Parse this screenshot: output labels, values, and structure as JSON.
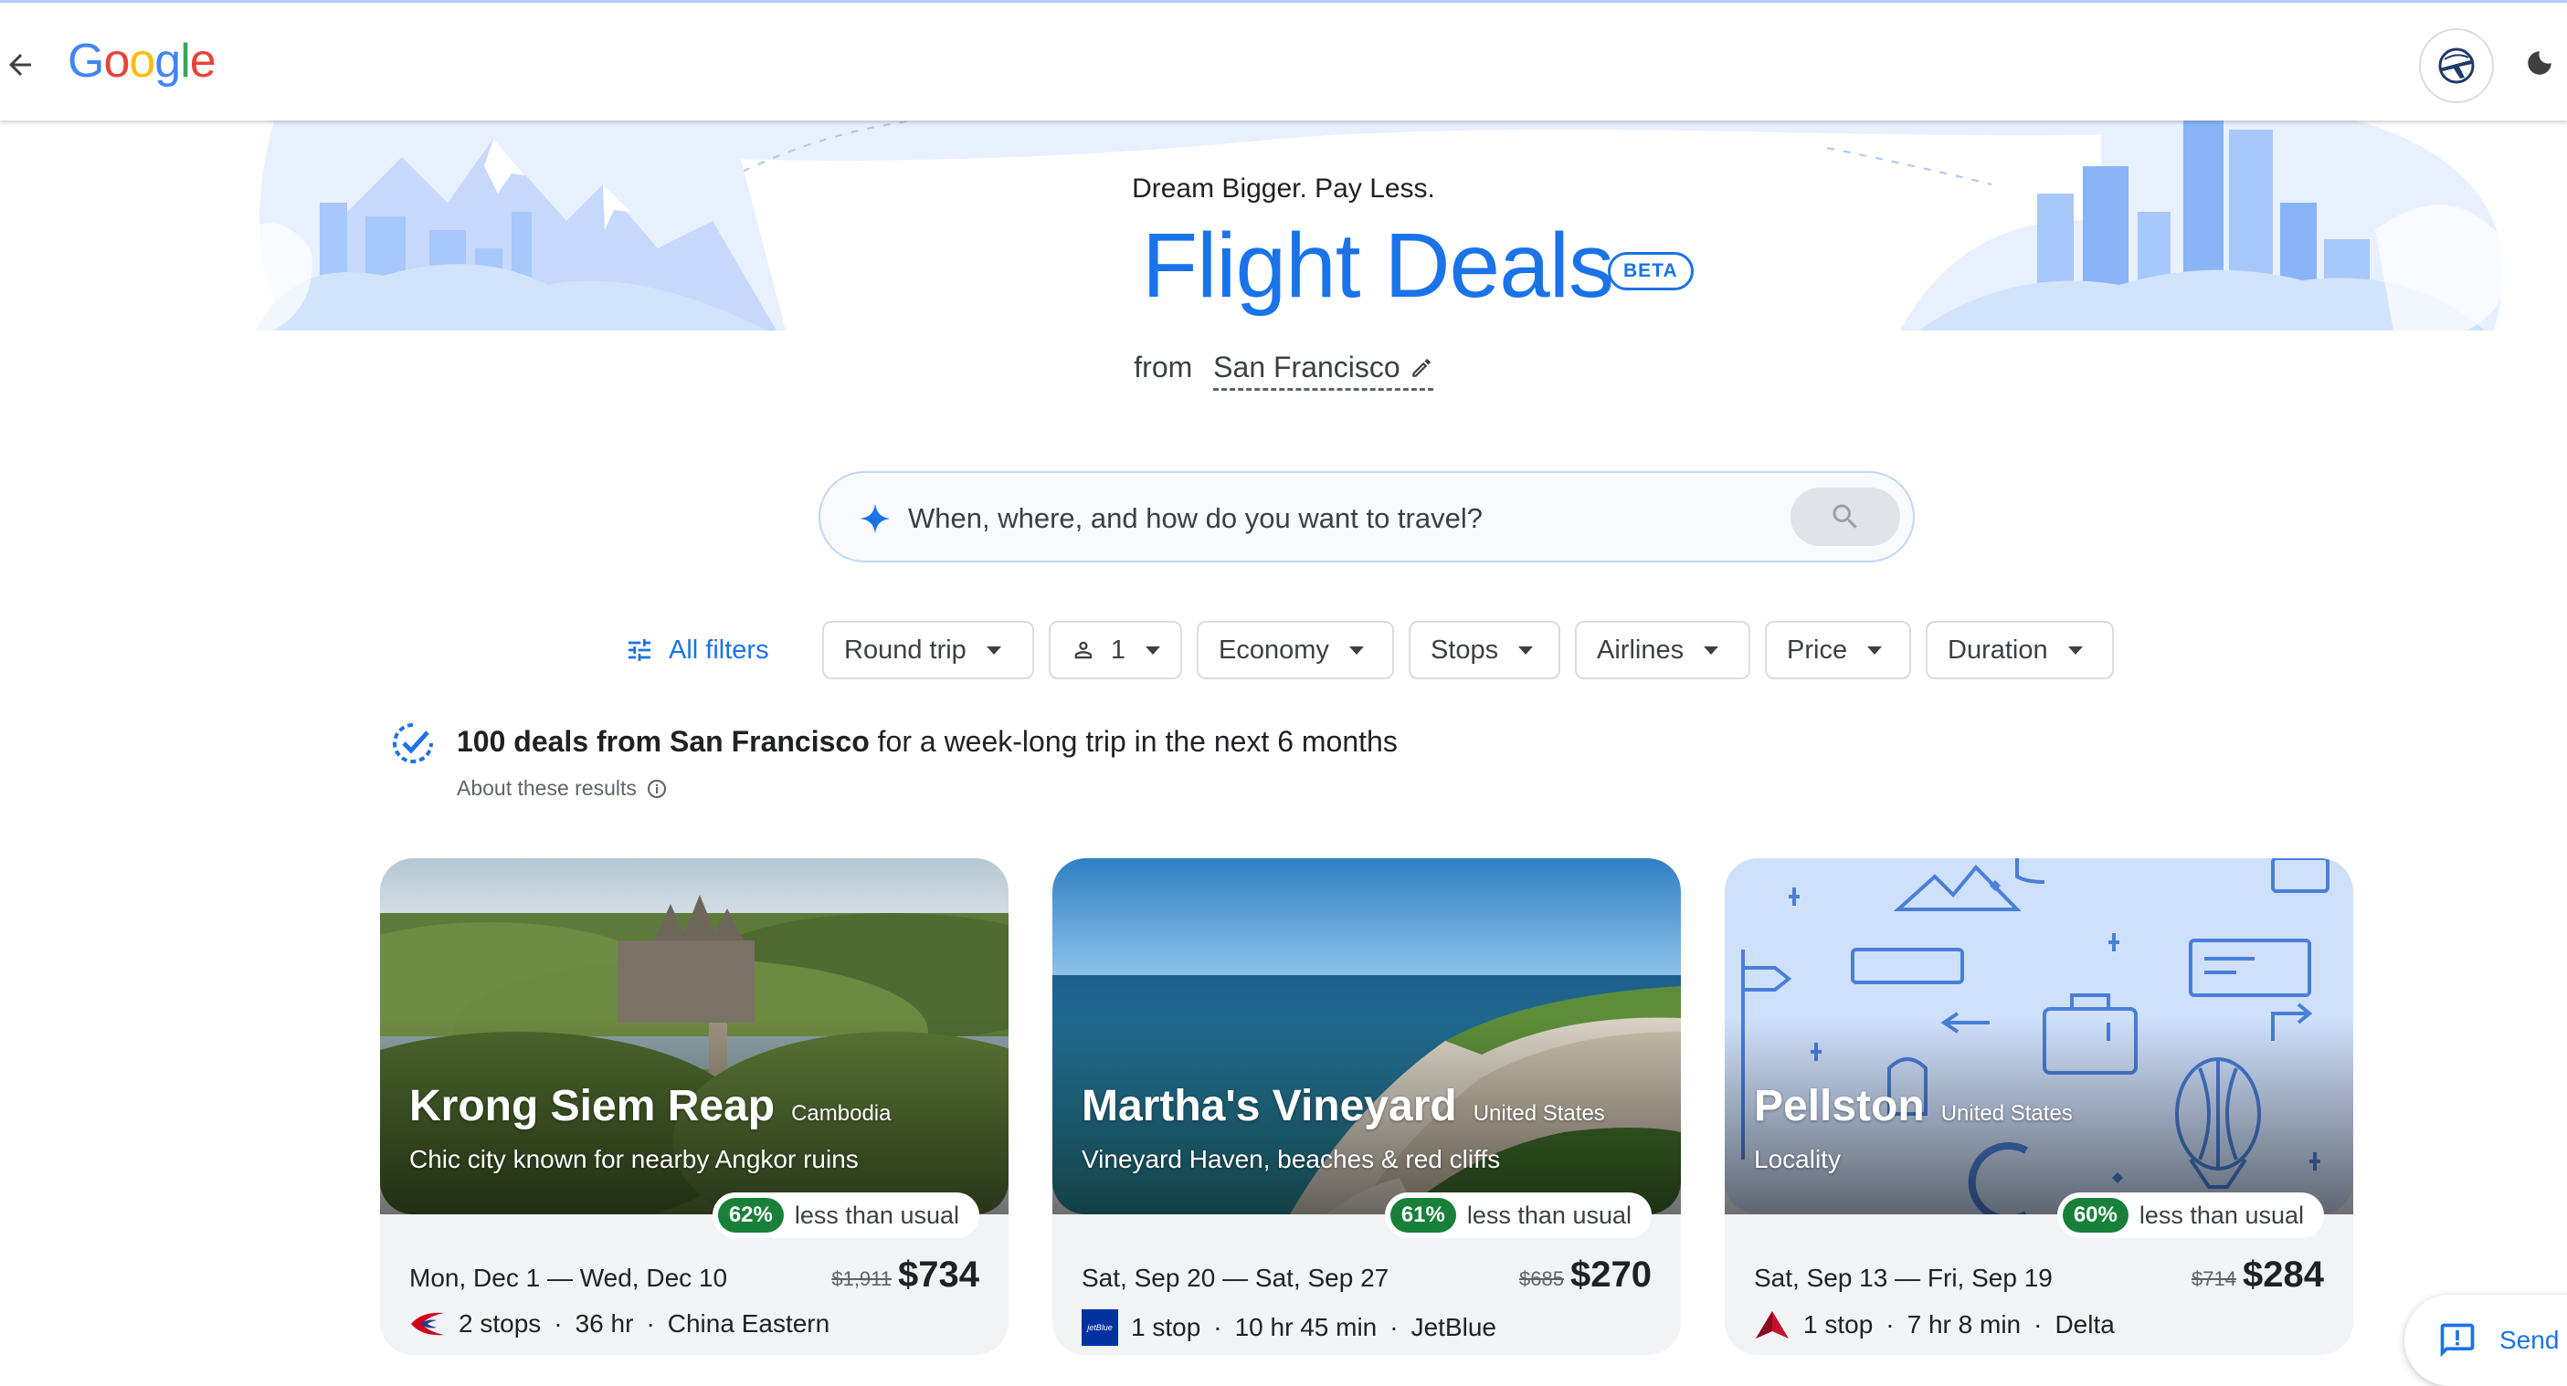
{
  "header": {
    "logo_letters": [
      "G",
      "o",
      "o",
      "g",
      "l",
      "e"
    ],
    "back_icon": "arrow-left-icon",
    "avatar_icon": "airplane-globe-icon",
    "theme_icon": "moon-icon"
  },
  "hero": {
    "tagline": "Dream Bigger. Pay Less.",
    "title": "Flight Deals",
    "badge": "BETA",
    "from_label": "from",
    "origin": "San Francisco"
  },
  "search": {
    "placeholder": "When, where, and how do you want to travel?",
    "icon": "sparkle-icon",
    "button_icon": "search-icon"
  },
  "filters": {
    "all_filters": "All filters",
    "chips": [
      "Round trip",
      "1",
      "Economy",
      "Stops",
      "Airlines",
      "Price",
      "Duration"
    ]
  },
  "summary": {
    "bold": "100 deals from San Francisco",
    "rest": " for a week-long trip in the next 6 months",
    "about": "About these results"
  },
  "deals": [
    {
      "destination": "Krong Siem Reap",
      "country": "Cambodia",
      "description": "Chic city known for nearby Angkor ruins",
      "percent": "62%",
      "percent_label": "less than usual",
      "dates": "Mon, Dec 1 — Wed, Dec 10",
      "old_price": "$1,911",
      "price": "$734",
      "stops": "2 stops",
      "duration": "36 hr",
      "airline": "China Eastern",
      "separator": "·",
      "airline_color": "#d0021b"
    },
    {
      "destination": "Martha's Vineyard",
      "country": "United States",
      "description": "Vineyard Haven, beaches & red cliffs",
      "percent": "61%",
      "percent_label": "less than usual",
      "dates": "Sat, Sep 20 — Sat, Sep 27",
      "old_price": "$685",
      "price": "$270",
      "stops": "1 stop",
      "duration": "10 hr 45 min",
      "airline": "JetBlue",
      "airline_logo_text": "jetBlue",
      "separator": "·",
      "airline_color": "#0033a0"
    },
    {
      "destination": "Pellston",
      "country": "United States",
      "description": "Locality",
      "percent": "60%",
      "percent_label": "less than usual",
      "dates": "Sat, Sep 13 — Fri, Sep 19",
      "old_price": "$714",
      "price": "$284",
      "stops": "1 stop",
      "duration": "7 hr 8 min",
      "airline": "Delta",
      "separator": "·",
      "airline_color": "#c8102e"
    }
  ],
  "feedback": {
    "label": "Send",
    "icon": "feedback-icon"
  },
  "colors": {
    "accent": "#1a73e8",
    "deal_green": "#188038",
    "card_bg": "#f1f3f4"
  }
}
